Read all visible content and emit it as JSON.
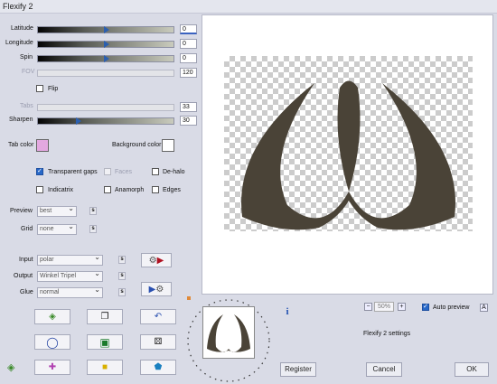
{
  "window": {
    "title": "Flexify 2"
  },
  "sliders": [
    {
      "label": "Latitude",
      "value": "0",
      "enabled": true
    },
    {
      "label": "Longitude",
      "value": "0",
      "enabled": true
    },
    {
      "label": "Spin",
      "value": "0",
      "enabled": true
    },
    {
      "label": "FOV",
      "value": "120",
      "enabled": false
    },
    {
      "label": "Tabs",
      "value": "33",
      "enabled": false
    },
    {
      "label": "Sharpen",
      "value": "30",
      "enabled": true
    }
  ],
  "flip": {
    "label": "Flip",
    "checked": false
  },
  "colors": {
    "tab_label": "Tab color",
    "tab_color": "#e3a8e0",
    "background_label": "Background color",
    "background_color": "#ffffff"
  },
  "options": {
    "transparent_gaps": "Transparent gaps",
    "faces": "Faces",
    "de_halo": "De-halo",
    "indicatrix": "Indicatrix",
    "anamorph": "Anamorph",
    "edges": "Edges"
  },
  "preview_select": {
    "label": "Preview",
    "value": "best",
    "s": "s"
  },
  "grid_select": {
    "label": "Grid",
    "value": "none",
    "s": "s"
  },
  "input_select": {
    "label": "Input",
    "value": "polar",
    "s": "s"
  },
  "output_select": {
    "label": "Output",
    "value": "Winkel Tripel",
    "s": "s"
  },
  "glue_select": {
    "label": "Glue",
    "value": "normal",
    "s": "s"
  },
  "zoom": {
    "minus": "−",
    "value": "50%",
    "plus": "+"
  },
  "auto_preview": {
    "label": "Auto preview",
    "checked": true,
    "a": "A"
  },
  "settings_label": "Flexify 2 settings",
  "info_label": "i",
  "buttons": {
    "register": "Register",
    "cancel": "Cancel",
    "ok": "OK"
  },
  "colors_ui": {
    "accent": "#2868c8",
    "shape": "#4a4337"
  }
}
